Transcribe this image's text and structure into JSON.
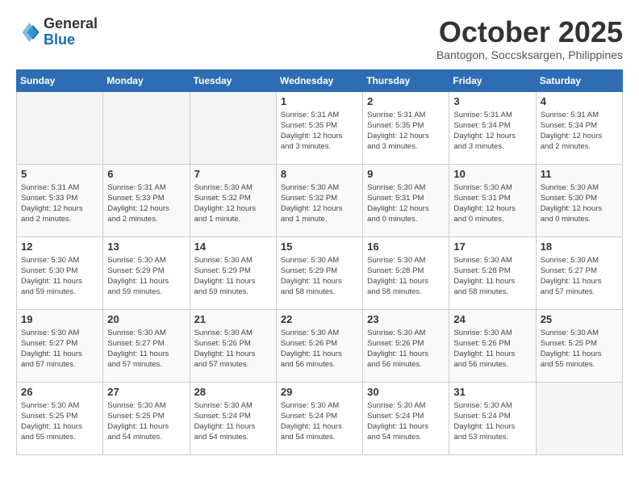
{
  "logo": {
    "general": "General",
    "blue": "Blue"
  },
  "header": {
    "month": "October 2025",
    "location": "Bantogon, Soccsksargen, Philippines"
  },
  "weekdays": [
    "Sunday",
    "Monday",
    "Tuesday",
    "Wednesday",
    "Thursday",
    "Friday",
    "Saturday"
  ],
  "weeks": [
    [
      {
        "day": "",
        "info": ""
      },
      {
        "day": "",
        "info": ""
      },
      {
        "day": "",
        "info": ""
      },
      {
        "day": "1",
        "info": "Sunrise: 5:31 AM\nSunset: 5:35 PM\nDaylight: 12 hours\nand 3 minutes."
      },
      {
        "day": "2",
        "info": "Sunrise: 5:31 AM\nSunset: 5:35 PM\nDaylight: 12 hours\nand 3 minutes."
      },
      {
        "day": "3",
        "info": "Sunrise: 5:31 AM\nSunset: 5:34 PM\nDaylight: 12 hours\nand 3 minutes."
      },
      {
        "day": "4",
        "info": "Sunrise: 5:31 AM\nSunset: 5:34 PM\nDaylight: 12 hours\nand 2 minutes."
      }
    ],
    [
      {
        "day": "5",
        "info": "Sunrise: 5:31 AM\nSunset: 5:33 PM\nDaylight: 12 hours\nand 2 minutes."
      },
      {
        "day": "6",
        "info": "Sunrise: 5:31 AM\nSunset: 5:33 PM\nDaylight: 12 hours\nand 2 minutes."
      },
      {
        "day": "7",
        "info": "Sunrise: 5:30 AM\nSunset: 5:32 PM\nDaylight: 12 hours\nand 1 minute."
      },
      {
        "day": "8",
        "info": "Sunrise: 5:30 AM\nSunset: 5:32 PM\nDaylight: 12 hours\nand 1 minute."
      },
      {
        "day": "9",
        "info": "Sunrise: 5:30 AM\nSunset: 5:31 PM\nDaylight: 12 hours\nand 0 minutes."
      },
      {
        "day": "10",
        "info": "Sunrise: 5:30 AM\nSunset: 5:31 PM\nDaylight: 12 hours\nand 0 minutes."
      },
      {
        "day": "11",
        "info": "Sunrise: 5:30 AM\nSunset: 5:30 PM\nDaylight: 12 hours\nand 0 minutes."
      }
    ],
    [
      {
        "day": "12",
        "info": "Sunrise: 5:30 AM\nSunset: 5:30 PM\nDaylight: 11 hours\nand 59 minutes."
      },
      {
        "day": "13",
        "info": "Sunrise: 5:30 AM\nSunset: 5:29 PM\nDaylight: 11 hours\nand 59 minutes."
      },
      {
        "day": "14",
        "info": "Sunrise: 5:30 AM\nSunset: 5:29 PM\nDaylight: 11 hours\nand 59 minutes."
      },
      {
        "day": "15",
        "info": "Sunrise: 5:30 AM\nSunset: 5:29 PM\nDaylight: 11 hours\nand 58 minutes."
      },
      {
        "day": "16",
        "info": "Sunrise: 5:30 AM\nSunset: 5:28 PM\nDaylight: 11 hours\nand 58 minutes."
      },
      {
        "day": "17",
        "info": "Sunrise: 5:30 AM\nSunset: 5:28 PM\nDaylight: 11 hours\nand 58 minutes."
      },
      {
        "day": "18",
        "info": "Sunrise: 5:30 AM\nSunset: 5:27 PM\nDaylight: 11 hours\nand 57 minutes."
      }
    ],
    [
      {
        "day": "19",
        "info": "Sunrise: 5:30 AM\nSunset: 5:27 PM\nDaylight: 11 hours\nand 57 minutes."
      },
      {
        "day": "20",
        "info": "Sunrise: 5:30 AM\nSunset: 5:27 PM\nDaylight: 11 hours\nand 57 minutes."
      },
      {
        "day": "21",
        "info": "Sunrise: 5:30 AM\nSunset: 5:26 PM\nDaylight: 11 hours\nand 57 minutes."
      },
      {
        "day": "22",
        "info": "Sunrise: 5:30 AM\nSunset: 5:26 PM\nDaylight: 11 hours\nand 56 minutes."
      },
      {
        "day": "23",
        "info": "Sunrise: 5:30 AM\nSunset: 5:26 PM\nDaylight: 11 hours\nand 56 minutes."
      },
      {
        "day": "24",
        "info": "Sunrise: 5:30 AM\nSunset: 5:26 PM\nDaylight: 11 hours\nand 56 minutes."
      },
      {
        "day": "25",
        "info": "Sunrise: 5:30 AM\nSunset: 5:25 PM\nDaylight: 11 hours\nand 55 minutes."
      }
    ],
    [
      {
        "day": "26",
        "info": "Sunrise: 5:30 AM\nSunset: 5:25 PM\nDaylight: 11 hours\nand 55 minutes."
      },
      {
        "day": "27",
        "info": "Sunrise: 5:30 AM\nSunset: 5:25 PM\nDaylight: 11 hours\nand 54 minutes."
      },
      {
        "day": "28",
        "info": "Sunrise: 5:30 AM\nSunset: 5:24 PM\nDaylight: 11 hours\nand 54 minutes."
      },
      {
        "day": "29",
        "info": "Sunrise: 5:30 AM\nSunset: 5:24 PM\nDaylight: 11 hours\nand 54 minutes."
      },
      {
        "day": "30",
        "info": "Sunrise: 5:30 AM\nSunset: 5:24 PM\nDaylight: 11 hours\nand 54 minutes."
      },
      {
        "day": "31",
        "info": "Sunrise: 5:30 AM\nSunset: 5:24 PM\nDaylight: 11 hours\nand 53 minutes."
      },
      {
        "day": "",
        "info": ""
      }
    ]
  ]
}
